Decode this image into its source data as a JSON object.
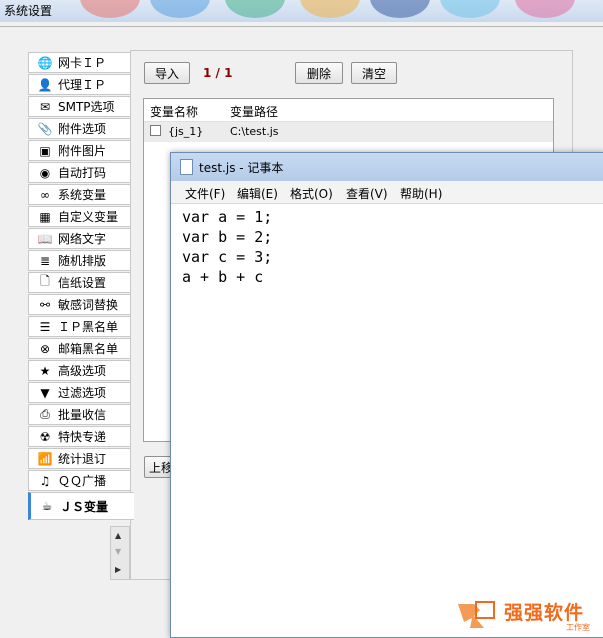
{
  "window": {
    "title": "系统设置"
  },
  "sidebar": {
    "items": [
      {
        "label": "网卡ＩＰ",
        "icon": "globe-icon",
        "glyph": "🌐"
      },
      {
        "label": "代理ＩＰ",
        "icon": "user-icon",
        "glyph": "👤"
      },
      {
        "label": "SMTP选项",
        "icon": "mail-icon",
        "glyph": "✉"
      },
      {
        "label": "附件选项",
        "icon": "paperclip-icon",
        "glyph": "📎"
      },
      {
        "label": "附件图片",
        "icon": "image-icon",
        "glyph": "▣"
      },
      {
        "label": "自动打码",
        "icon": "eye-icon",
        "glyph": "◉"
      },
      {
        "label": "系统变量",
        "icon": "infinity-icon",
        "glyph": "∞"
      },
      {
        "label": "自定义变量",
        "icon": "grid-icon",
        "glyph": "▦"
      },
      {
        "label": "网络文字",
        "icon": "book-icon",
        "glyph": "📖"
      },
      {
        "label": "随机排版",
        "icon": "layers-icon",
        "glyph": "≣"
      },
      {
        "label": "信纸设置",
        "icon": "document-icon",
        "glyph": "🗋"
      },
      {
        "label": "敏感词替换",
        "icon": "share-icon",
        "glyph": "⚯"
      },
      {
        "label": "ＩＰ黑名单",
        "icon": "list-icon",
        "glyph": "☰"
      },
      {
        "label": "邮箱黑名单",
        "icon": "block-icon",
        "glyph": "⊗"
      },
      {
        "label": "高级选项",
        "icon": "star-icon",
        "glyph": "★"
      },
      {
        "label": "过滤选项",
        "icon": "filter-icon",
        "glyph": "▼"
      },
      {
        "label": "批量收信",
        "icon": "inbox-icon",
        "glyph": "⎙"
      },
      {
        "label": "特快专递",
        "icon": "radiation-icon",
        "glyph": "☢"
      },
      {
        "label": "统计退订",
        "icon": "chart-icon",
        "glyph": "📶"
      },
      {
        "label": "ＱＱ广播",
        "icon": "qq-icon",
        "glyph": "♫"
      },
      {
        "label": "ＪＳ变量",
        "icon": "cup-icon",
        "glyph": "☕"
      }
    ]
  },
  "toolbar": {
    "import": "导入",
    "page": "1 / 1",
    "delete": "删除",
    "clear": "清空"
  },
  "table": {
    "headers": [
      "变量名称",
      "变量路径"
    ],
    "rows": [
      {
        "name": "{js_1}",
        "path": "C:\\test.js"
      }
    ]
  },
  "panel": {
    "up_button": "上移"
  },
  "notepad": {
    "title": "test.js - 记事本",
    "menu": [
      "文件(F)",
      "编辑(E)",
      "格式(O)",
      "查看(V)",
      "帮助(H)"
    ],
    "content": "var a = 1;\nvar b = 2;\nvar c = 3;\na + b + c"
  },
  "watermark": {
    "text": "强强软件",
    "sub": "工作室"
  }
}
